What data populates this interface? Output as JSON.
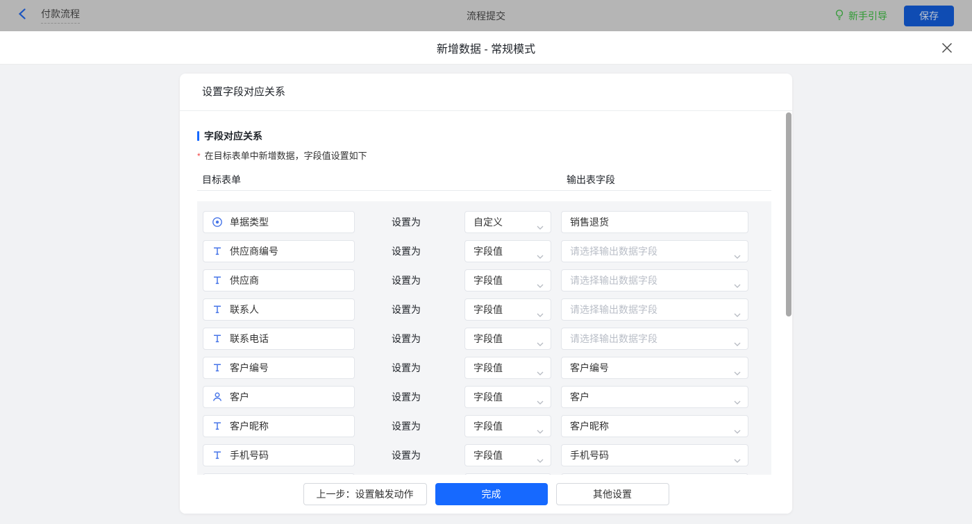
{
  "topbar": {
    "back_label": "付款流程",
    "center_title": "流程提交",
    "guide_label": "新手引导",
    "save_label": "保存"
  },
  "modal": {
    "title": "新增数据 - 常规模式"
  },
  "card": {
    "header": "设置字段对应关系",
    "section_title": "字段对应关系",
    "required_note": "在目标表单中新增数据，字段值设置如下",
    "col_left": "目标表单",
    "col_right": "输出表字段",
    "set_as_label": "设置为",
    "value_placeholder": "请选择输出数据字段"
  },
  "rows": [
    {
      "field": "单据类型",
      "icon": "radio-icon",
      "op": "自定义",
      "value": "销售退货",
      "value_kind": "input"
    },
    {
      "field": "供应商编号",
      "icon": "text-icon",
      "op": "字段值",
      "value": "",
      "value_kind": "placeholder"
    },
    {
      "field": "供应商",
      "icon": "text-icon",
      "op": "字段值",
      "value": "",
      "value_kind": "placeholder"
    },
    {
      "field": "联系人",
      "icon": "text-icon",
      "op": "字段值",
      "value": "",
      "value_kind": "placeholder"
    },
    {
      "field": "联系电话",
      "icon": "text-icon",
      "op": "字段值",
      "value": "",
      "value_kind": "placeholder"
    },
    {
      "field": "客户编号",
      "icon": "text-icon",
      "op": "字段值",
      "value": "客户编号",
      "value_kind": "selected"
    },
    {
      "field": "客户",
      "icon": "user-icon",
      "op": "字段值",
      "value": "客户",
      "value_kind": "selected"
    },
    {
      "field": "客户昵称",
      "icon": "text-icon",
      "op": "字段值",
      "value": "客户昵称",
      "value_kind": "selected"
    },
    {
      "field": "手机号码",
      "icon": "text-icon",
      "op": "字段值",
      "value": "手机号码",
      "value_kind": "selected"
    },
    {
      "field": "",
      "icon": "",
      "op": "",
      "value": "",
      "value_kind": "clipped"
    }
  ],
  "footer": {
    "prev_label": "上一步：设置触发动作",
    "done_label": "完成",
    "other_label": "其他设置"
  },
  "colors": {
    "accent_blue": "#1669ff",
    "field_icon_blue": "#4775e8",
    "guide_green": "#2f9a33",
    "required_red": "#f24242",
    "dimmed_topbar": "#b5b5b5",
    "dimmed_save_bg": "#0f4cb3",
    "panel_bg": "#f4f5f7",
    "placeholder_gray": "#b9bec7"
  }
}
